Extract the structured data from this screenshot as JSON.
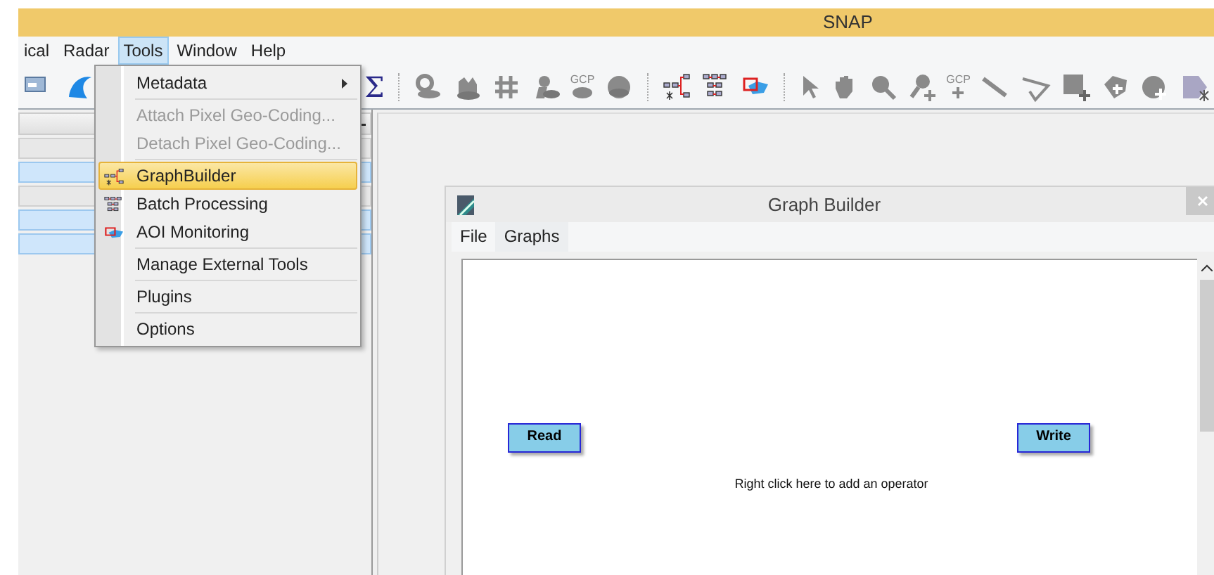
{
  "window": {
    "title": "SNAP"
  },
  "menu_bar": [
    {
      "label": "ical",
      "selected": false
    },
    {
      "label": "Radar",
      "selected": false
    },
    {
      "label": "Tools",
      "selected": true
    },
    {
      "label": "Window",
      "selected": false
    },
    {
      "label": "Help",
      "selected": false
    }
  ],
  "toolbar": {
    "sum_symbol": "Σ",
    "gcp_labels": [
      "GCP",
      "GCP"
    ]
  },
  "left_panel": {
    "rows": [
      {
        "selected": false
      },
      {
        "selected": true
      },
      {
        "selected": false
      },
      {
        "selected": true
      },
      {
        "selected": true
      }
    ]
  },
  "tools_menu": [
    {
      "kind": "item",
      "label": "Metadata",
      "submenu": true,
      "disabled": false,
      "selected": false
    },
    {
      "kind": "separator"
    },
    {
      "kind": "item",
      "label": "Attach Pixel Geo-Coding...",
      "submenu": false,
      "disabled": true,
      "selected": false
    },
    {
      "kind": "item",
      "label": "Detach Pixel Geo-Coding...",
      "submenu": false,
      "disabled": true,
      "selected": false
    },
    {
      "kind": "separator"
    },
    {
      "kind": "item",
      "label": "GraphBuilder",
      "submenu": false,
      "disabled": false,
      "selected": true
    },
    {
      "kind": "item",
      "label": "Batch Processing",
      "submenu": false,
      "disabled": false,
      "selected": false
    },
    {
      "kind": "item",
      "label": "AOI Monitoring",
      "submenu": false,
      "disabled": false,
      "selected": false
    },
    {
      "kind": "separator"
    },
    {
      "kind": "item",
      "label": "Manage External Tools",
      "submenu": false,
      "disabled": false,
      "selected": false
    },
    {
      "kind": "separator"
    },
    {
      "kind": "item",
      "label": "Plugins",
      "submenu": false,
      "disabled": false,
      "selected": false
    },
    {
      "kind": "separator"
    },
    {
      "kind": "item",
      "label": "Options",
      "submenu": false,
      "disabled": false,
      "selected": false
    }
  ],
  "graph_builder": {
    "title": "Graph Builder",
    "menu": [
      "File",
      "Graphs"
    ],
    "nodes": [
      {
        "label": "Read"
      },
      {
        "label": "Write"
      }
    ],
    "hint": "Right click here to add an operator"
  }
}
